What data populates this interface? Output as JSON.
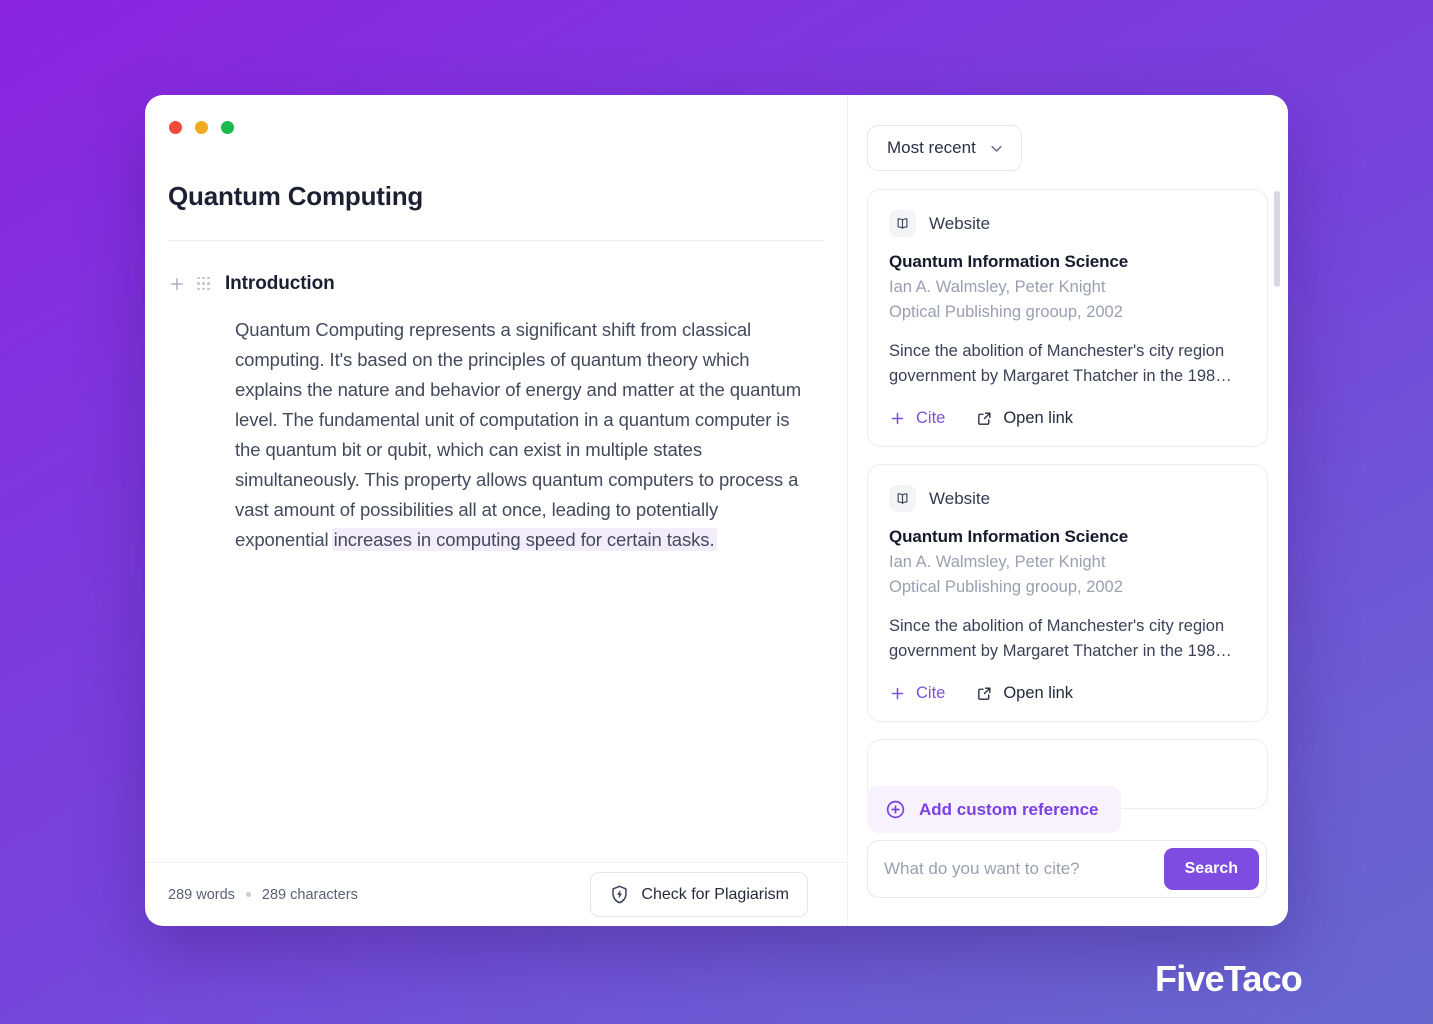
{
  "brand": {
    "name": "FiveTaco"
  },
  "window": {
    "traffic_lights": [
      {
        "name": "close",
        "color": "#ee4b3c"
      },
      {
        "name": "minimize",
        "color": "#eeab1c"
      },
      {
        "name": "maximize",
        "color": "#1aba4d"
      }
    ]
  },
  "editor": {
    "doc_title": "Quantum Computing",
    "add_block_icon": "plus-icon",
    "drag_handle_icon": "drag-handle-icon",
    "section_title": "Introduction",
    "paragraph_plain": "Quantum Computing represents a significant shift from classical computing. It's based on the principles of quantum theory which explains the nature and behavior of energy and matter at the quantum level. The fundamental unit of computation in a quantum computer is the quantum bit or qubit, which can exist in multiple states simultaneously. This property allows quantum computers to process a vast amount of possibilities all at once, leading to potentially exponential ",
    "paragraph_highlighted": "increases in computing speed for certain tasks.",
    "highlight_color": "#f3ecfb",
    "footer": {
      "word_count": "289 words",
      "character_count": "289 characters",
      "plagiarism_label": "Check for Plagiarism",
      "plagiarism_icon": "shield-bolt-icon"
    }
  },
  "references": {
    "sort": {
      "selected": "Most recent",
      "chevron_icon": "chevron-down-icon"
    },
    "cards": [
      {
        "type_label": "Website",
        "type_icon": "open-book-icon",
        "title": "Quantum Information Science",
        "authors": "Ian A. Walmsley, Peter Knight",
        "publisher": "Optical Publishing grooup, 2002",
        "snippet": "Since the abolition of Manchester's city region government by Margaret Thatcher in the 198…",
        "cite_label": "Cite",
        "cite_icon": "plus-icon",
        "open_label": "Open link",
        "open_icon": "external-link-icon"
      },
      {
        "type_label": "Website",
        "type_icon": "open-book-icon",
        "title": "Quantum Information Science",
        "authors": "Ian A. Walmsley, Peter Knight",
        "publisher": "Optical Publishing grooup, 2002",
        "snippet": "Since the abolition of Manchester's city region government by Margaret Thatcher in the 198…",
        "cite_label": "Cite",
        "cite_icon": "plus-icon",
        "open_label": "Open link",
        "open_icon": "external-link-icon"
      }
    ],
    "add_custom": {
      "label": "Add custom reference",
      "icon": "plus-circle-icon",
      "accent": "#7b3fe4"
    },
    "search": {
      "value": "",
      "placeholder": "What do you want to cite?",
      "button_label": "Search",
      "button_color": "#7e4ce0"
    },
    "scrollbar": {
      "name": "vertical-scrollbar"
    }
  }
}
